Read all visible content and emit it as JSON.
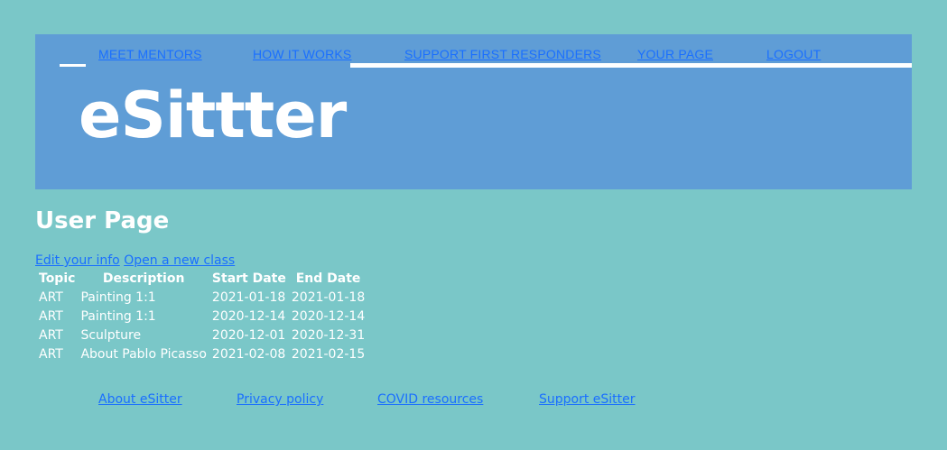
{
  "nav": {
    "items": [
      {
        "label": "MEET MENTORS"
      },
      {
        "label": "HOW IT WORKS"
      },
      {
        "label": "SUPPORT FIRST RESPONDERS"
      },
      {
        "label": "YOUR PAGE"
      },
      {
        "label": "LOGOUT"
      }
    ]
  },
  "header": {
    "logo": "eSittter"
  },
  "main": {
    "title": "User Page",
    "actions": {
      "edit_info": "Edit your info",
      "open_class": "Open a new class"
    },
    "table": {
      "headers": [
        "Topic",
        "Description",
        "Start Date",
        "End Date"
      ],
      "rows": [
        [
          "ART",
          "Painting 1:1",
          "2021-01-18",
          "2021-01-18"
        ],
        [
          "ART",
          "Painting 1:1",
          "2020-12-14",
          "2020-12-14"
        ],
        [
          "ART",
          "Sculpture",
          "2020-12-01",
          "2020-12-31"
        ],
        [
          "ART",
          "About Pablo Picasso",
          "2021-02-08",
          "2021-02-15"
        ]
      ]
    }
  },
  "footer": {
    "links": [
      {
        "label": "About eSitter"
      },
      {
        "label": "Privacy policy"
      },
      {
        "label": "COVID resources"
      },
      {
        "label": "Support eSitter"
      }
    ]
  },
  "colors": {
    "page_background": "#7ac7c8",
    "header_background": "#5f9dd6",
    "link": "#1a6fff",
    "text": "#ffffff"
  }
}
